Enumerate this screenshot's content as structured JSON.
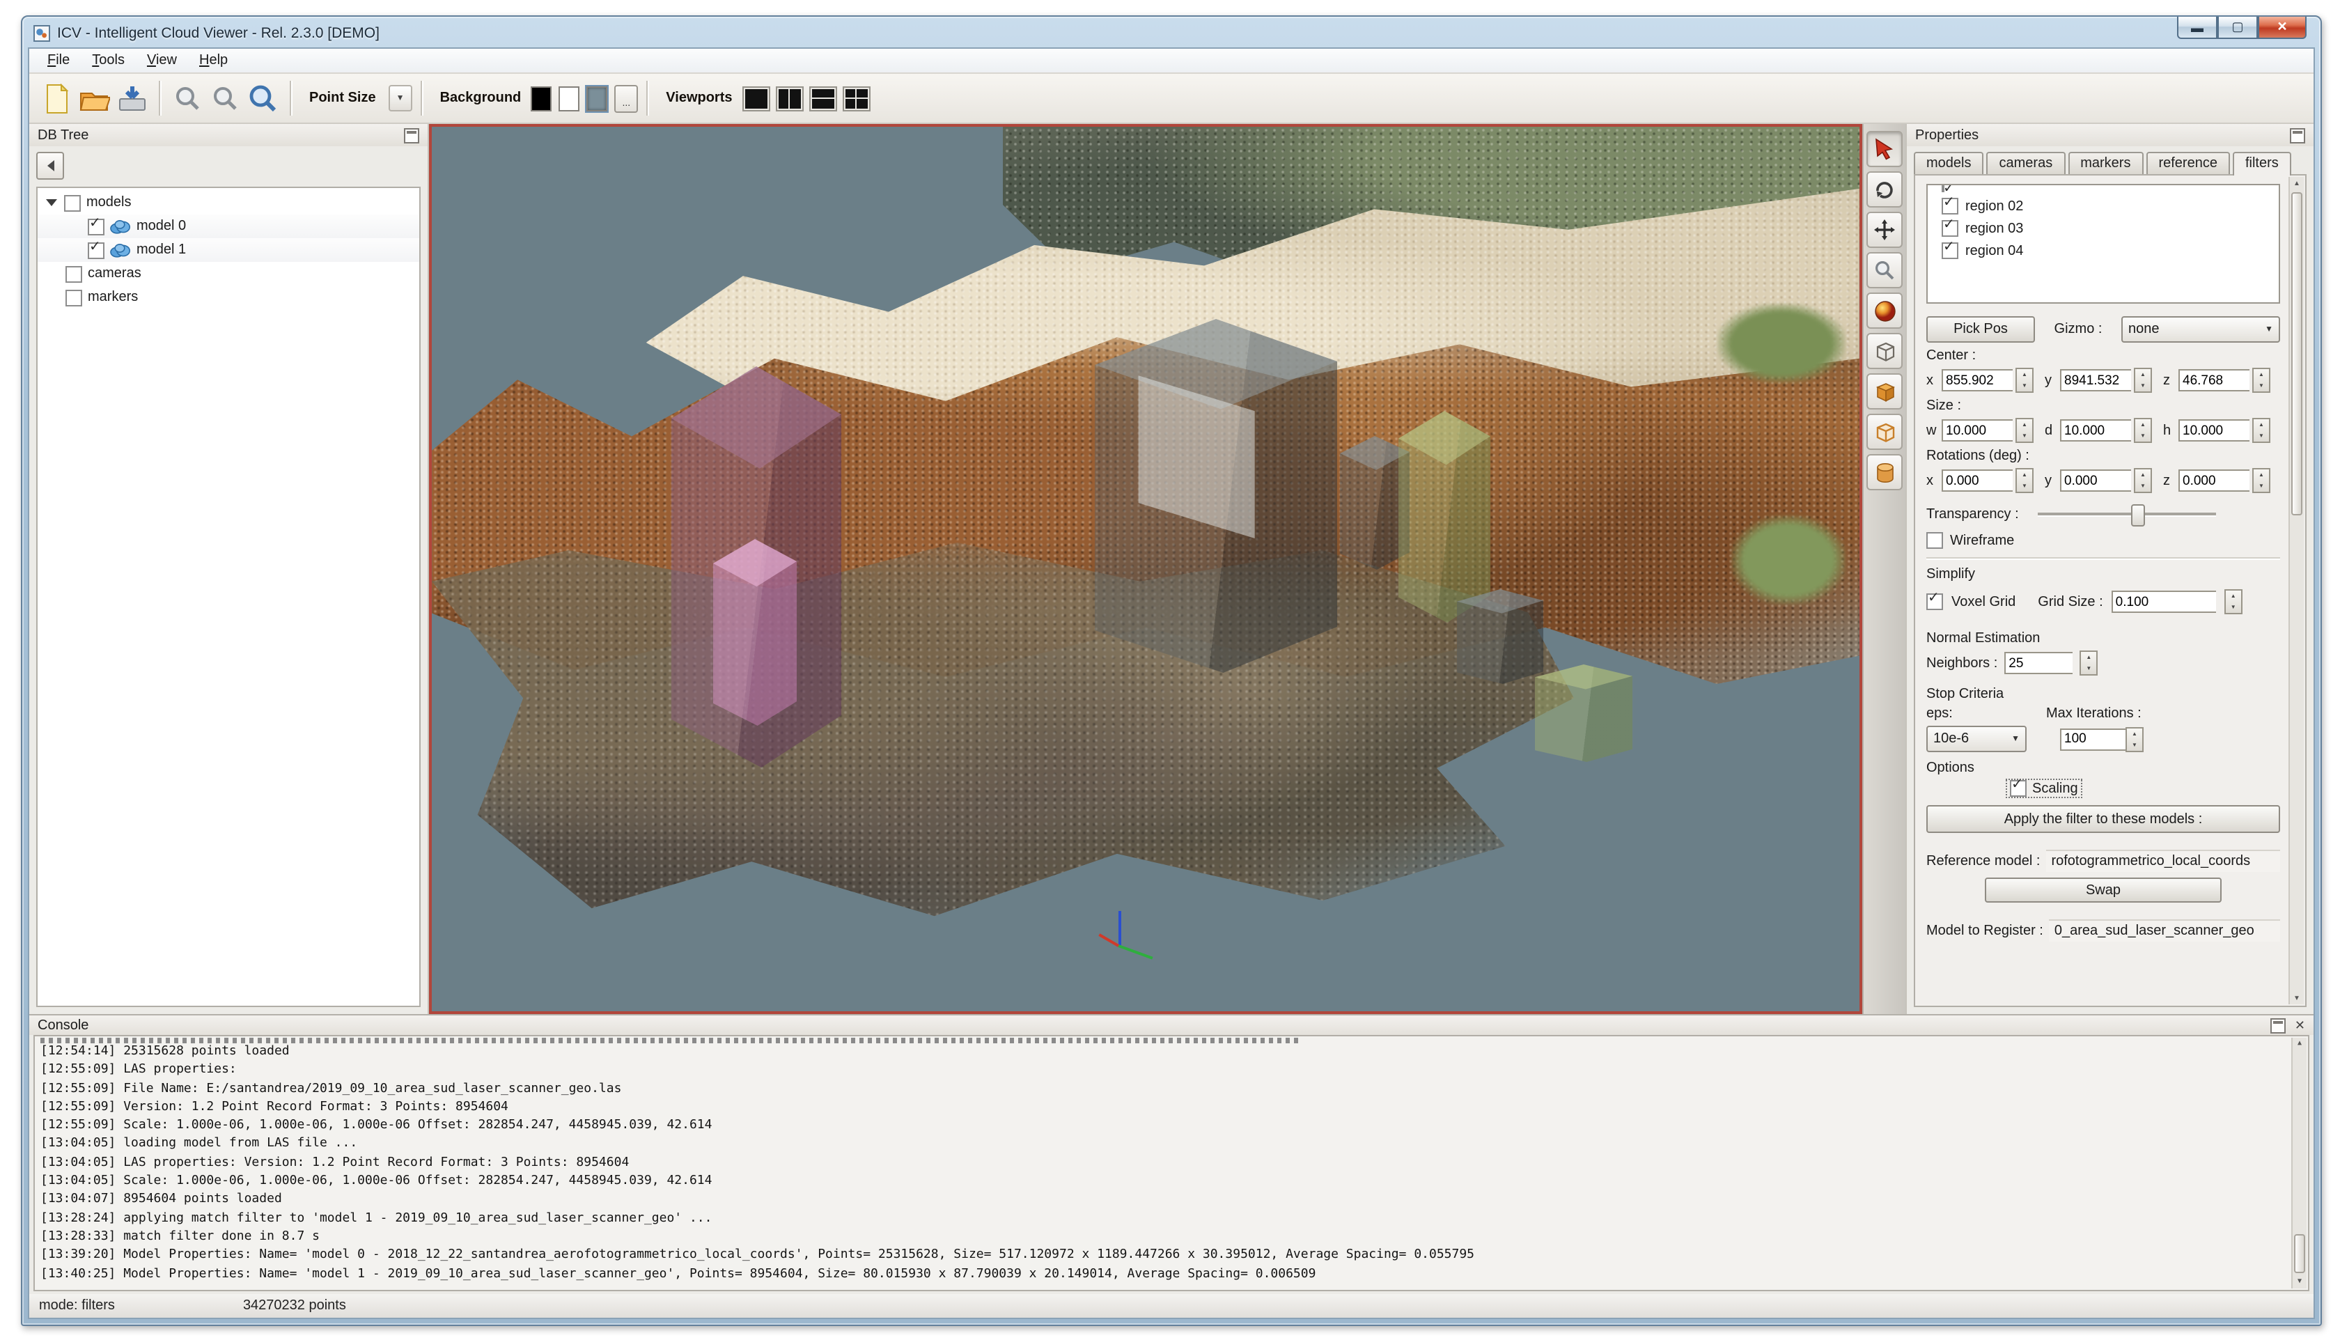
{
  "window": {
    "title": "ICV - Intelligent Cloud Viewer - Rel. 2.3.0 [DEMO]"
  },
  "menu": {
    "items": [
      "File",
      "Tools",
      "View",
      "Help"
    ]
  },
  "toolbar": {
    "point_size_label": "Point Size",
    "background_label": "Background",
    "background_more_label": "...",
    "viewports_label": "Viewports",
    "swatch_colors": [
      "#000000",
      "#ffffff",
      "#7b8f99"
    ]
  },
  "db_tree": {
    "title": "DB Tree",
    "items": [
      {
        "label": "models",
        "checked": false
      },
      {
        "label": "model 0",
        "checked": true
      },
      {
        "label": "model 1",
        "checked": true
      },
      {
        "label": "cameras",
        "checked": false
      },
      {
        "label": "markers",
        "checked": false
      }
    ]
  },
  "properties": {
    "title": "Properties",
    "tabs": [
      "models",
      "cameras",
      "markers",
      "reference",
      "filters"
    ],
    "active_tab": "filters",
    "regions": [
      {
        "label": "region 02",
        "checked": true
      },
      {
        "label": "region 03",
        "checked": true
      },
      {
        "label": "region 04",
        "checked": true
      }
    ],
    "pick_pos_label": "Pick Pos",
    "gizmo_label": "Gizmo :",
    "gizmo_value": "none",
    "center_label": "Center :",
    "center_axes": [
      "x",
      "y",
      "z"
    ],
    "center": {
      "x": "855.902",
      "y": "8941.532",
      "z": "46.768"
    },
    "size_label": "Size :",
    "size_axes": [
      "w",
      "d",
      "h"
    ],
    "size": {
      "w": "10.000",
      "d": "10.000",
      "h": "10.000"
    },
    "rotations_label": "Rotations (deg) :",
    "rotations_axes": [
      "x",
      "y",
      "z"
    ],
    "rotations": {
      "x": "0.000",
      "y": "0.000",
      "z": "0.000"
    },
    "transparency_label": "Transparency :",
    "wireframe_label": "Wireframe",
    "simplify_label": "Simplify",
    "voxel_grid_label": "Voxel Grid",
    "grid_size_label": "Grid Size :",
    "grid_size_value": "0.100",
    "normal_estimation_label": "Normal Estimation",
    "neighbors_label": "Neighbors :",
    "neighbors_value": "25",
    "stop_criteria_label": "Stop Criteria",
    "eps_label": "eps:",
    "eps_value": "10e-6",
    "max_iterations_label": "Max Iterations :",
    "max_iterations_value": "100",
    "options_label": "Options",
    "scaling_label": "Scaling",
    "apply_button": "Apply the filter to these models :",
    "reference_model_label": "Reference model :",
    "reference_model_value": "rofotogrammetrico_local_coords",
    "swap_button": "Swap",
    "model_to_register_label": "Model to Register :",
    "model_to_register_value": "0_area_sud_laser_scanner_geo"
  },
  "console": {
    "title": "Console",
    "lines": [
      "[12:54:14] 25315628  points loaded",
      "[12:55:09] LAS properties:",
      "[12:55:09] File Name: E:/santandrea/2019_09_10_area_sud_laser_scanner_geo.las",
      "[12:55:09] Version: 1.2   Point Record Format: 3   Points: 8954604",
      "[12:55:09] Scale: 1.000e-06, 1.000e-06, 1.000e-06   Offset: 282854.247, 4458945.039, 42.614",
      "[13:04:05] loading model from LAS file ...",
      "[13:04:05] LAS properties: Version: 1.2   Point Record Format: 3   Points: 8954604",
      "[13:04:05] Scale: 1.000e-06, 1.000e-06, 1.000e-06   Offset: 282854.247, 4458945.039, 42.614",
      "[13:04:07] 8954604  points loaded",
      "[13:28:24] applying match filter to  'model 1 - 2019_09_10_area_sud_laser_scanner_geo' ...",
      "[13:28:33] match filter done in 8.7 s",
      "[13:39:20] Model Properties:   Name= 'model 0 - 2018_12_22_santandrea_aerofotogrammetrico_local_coords',   Points= 25315628,   Size= 517.120972 x 1189.447266 x 30.395012,   Average Spacing=  0.055795",
      "[13:40:25] Model Properties:   Name= 'model 1 - 2019_09_10_area_sud_laser_scanner_geo',   Points= 8954604,   Size= 80.015930 x 87.790039 x 20.149014,   Average Spacing=  0.006509"
    ]
  },
  "status": {
    "mode": "mode: filters",
    "points": "34270232 points"
  },
  "colors": {
    "viewport_background": "#6b7f88",
    "viewport_border": "#b1463b",
    "region_box_purple": "#8b5e7e",
    "region_box_gray": "#3c4346",
    "region_box_green": "#8ca35c",
    "titlebar_blue": "#a7c2d8",
    "close_button_red": "#bf3a21"
  },
  "icons": {
    "toolbar": [
      "new-file",
      "open-file",
      "save-file",
      "zoom-out",
      "zoom",
      "zoom-in"
    ],
    "viewport_layouts": [
      "single",
      "dual-vertical",
      "dual-horizontal",
      "quad"
    ],
    "tool_strip": [
      "pick-cursor",
      "orbit",
      "pan",
      "zoom-glass",
      "color-sphere",
      "wire-box",
      "solid-box",
      "frame-box",
      "cylinder"
    ]
  }
}
